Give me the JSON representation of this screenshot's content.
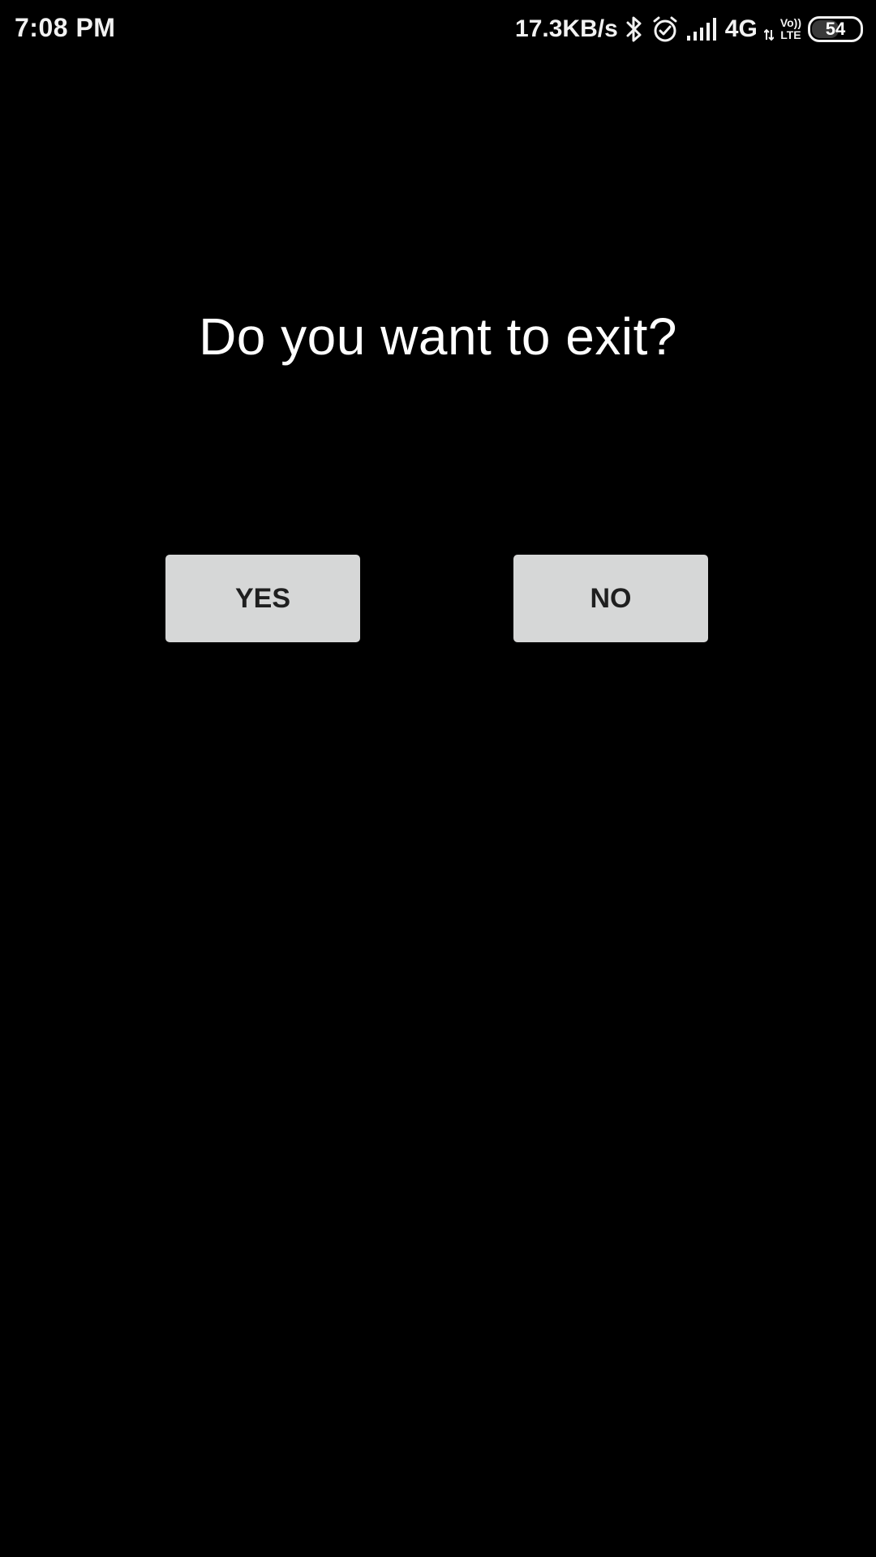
{
  "status_bar": {
    "time": "7:08 PM",
    "net_speed": "17.3KB/s",
    "network_type": "4G",
    "volte_top": "Vo))",
    "volte_bottom": "LTE",
    "battery_level": "54",
    "battery_fraction": 0.54,
    "icons": [
      "bluetooth-icon",
      "alarm-icon",
      "signal-icon",
      "data-arrows-icon"
    ]
  },
  "dialog": {
    "prompt": "Do you want to exit?",
    "yes_label": "YES",
    "no_label": "NO"
  },
  "colors": {
    "background": "#000000",
    "button_bg": "#d6d7d7",
    "button_text": "#1f1f1f",
    "text": "#ffffff"
  }
}
